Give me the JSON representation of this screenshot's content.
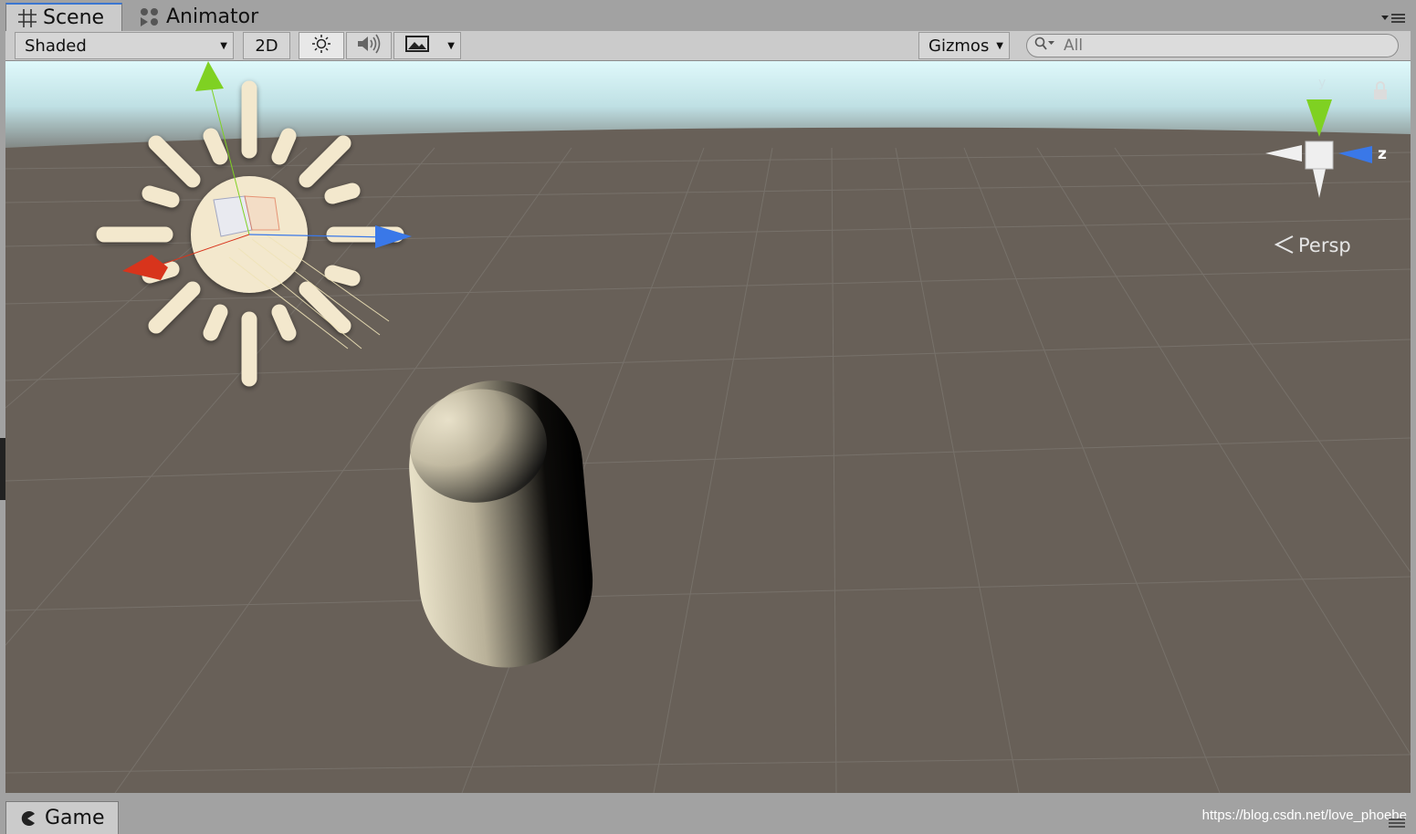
{
  "tabs": {
    "scene": "Scene",
    "animator": "Animator",
    "game": "Game"
  },
  "toolbar": {
    "shading_mode": "Shaded",
    "mode_2d": "2D",
    "gizmos": "Gizmos",
    "search_placeholder": "All"
  },
  "viewport": {
    "projection": "Persp",
    "axis_y": "y",
    "axis_z": "z"
  },
  "watermark": "https://blog.csdn.net/love_phoebe",
  "colors": {
    "panel_bg": "#a2a2a2",
    "toolbar_bg": "#cbcbcb",
    "active_tab_accent": "#3b76d0",
    "ground": "#686058",
    "sky": "#d8f6f8",
    "sun_gizmo": "#f3e8cd",
    "axis_x": "#d8341c",
    "axis_y": "#7fd122",
    "axis_z": "#3a78e8"
  },
  "icons": [
    "grid-icon",
    "animator-icon",
    "sun-icon",
    "audio-icon",
    "image-icon",
    "search-icon",
    "panel-menu-icon",
    "pacman-icon",
    "lock-icon"
  ]
}
